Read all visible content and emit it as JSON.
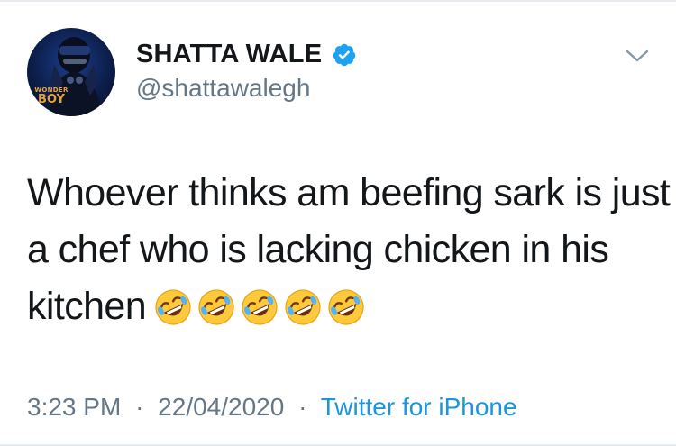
{
  "tweet": {
    "author": {
      "display_name": "SHATTA WALE",
      "handle": "@shattawalegh",
      "verified": true,
      "avatar_text": "WONDER BOY"
    },
    "text_lines": [
      "Whoever thinks am beefing sark is just",
      "a chef who is lacking chicken in his",
      "kitchen"
    ],
    "emojis": [
      "rolling-on-floor-laughing",
      "rolling-on-floor-laughing",
      "rolling-on-floor-laughing",
      "rolling-on-floor-laughing",
      "rolling-on-floor-laughing"
    ],
    "time": "3:23 PM",
    "date": "22/04/2020",
    "separator": "·",
    "source": "Twitter for iPhone"
  },
  "colors": {
    "text": "#14171a",
    "muted": "#657786",
    "link": "#1b95e0",
    "verified": "#1da1f2"
  }
}
